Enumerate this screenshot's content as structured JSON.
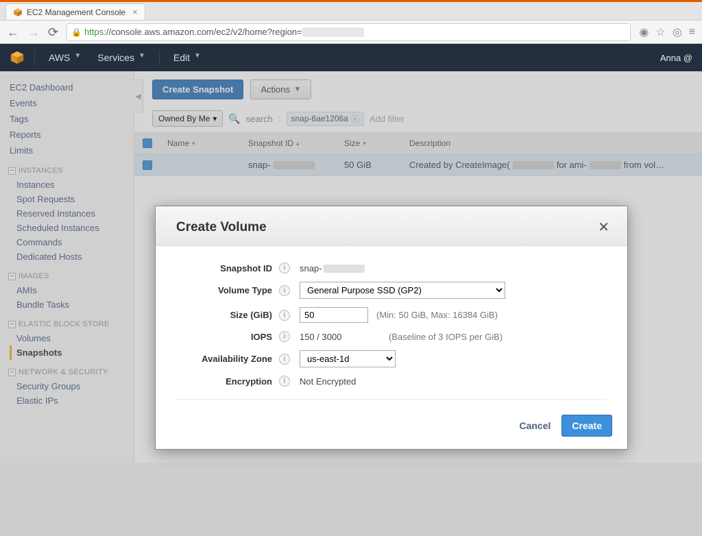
{
  "browser": {
    "tab_title": "EC2 Management Console",
    "url_https": "https",
    "url_host_path": "://console.aws.amazon.com/ec2/v2/home?region="
  },
  "topnav": {
    "aws_label": "AWS",
    "services_label": "Services",
    "edit_label": "Edit",
    "user_label": "Anna @"
  },
  "sidebar": {
    "primary": [
      "EC2 Dashboard",
      "Events",
      "Tags",
      "Reports",
      "Limits"
    ],
    "sections": [
      {
        "title": "INSTANCES",
        "items": [
          "Instances",
          "Spot Requests",
          "Reserved Instances",
          "Scheduled Instances",
          "Commands",
          "Dedicated Hosts"
        ]
      },
      {
        "title": "IMAGES",
        "items": [
          "AMIs",
          "Bundle Tasks"
        ]
      },
      {
        "title": "ELASTIC BLOCK STORE",
        "items": [
          "Volumes",
          "Snapshots"
        ],
        "active_index": 1
      },
      {
        "title": "NETWORK & SECURITY",
        "items": [
          "Security Groups",
          "Elastic IPs"
        ]
      }
    ]
  },
  "toolbar": {
    "create_snapshot_label": "Create Snapshot",
    "actions_label": "Actions"
  },
  "filter": {
    "owned_label": "Owned By Me",
    "search_label": "search",
    "search_sep": ":",
    "search_value": "snap-6ae1206a",
    "add_filter_label": "Add filter"
  },
  "table": {
    "cols": {
      "name": "Name",
      "snap": "Snapshot ID",
      "size": "Size",
      "desc": "Description"
    },
    "row": {
      "name": "",
      "snap_prefix": "snap-",
      "size": "50 GiB",
      "desc_prefix": "Created by CreateImage(",
      "desc_mid": " for ami-",
      "desc_suffix": " from vol…"
    }
  },
  "modal": {
    "title": "Create Volume",
    "labels": {
      "snapshot_id": "Snapshot ID",
      "volume_type": "Volume Type",
      "size": "Size (GiB)",
      "iops": "IOPS",
      "az": "Availability Zone",
      "encryption": "Encryption"
    },
    "values": {
      "snapshot_prefix": "snap-",
      "volume_type": "General Purpose SSD (GP2)",
      "size": "50",
      "size_hint": "(Min: 50 GiB, Max: 16384 GiB)",
      "iops": "150 / 3000",
      "iops_hint": "(Baseline of 3 IOPS per GiB)",
      "az": "us-east-1d",
      "encryption": "Not Encrypted"
    },
    "footer": {
      "cancel": "Cancel",
      "create": "Create"
    }
  }
}
